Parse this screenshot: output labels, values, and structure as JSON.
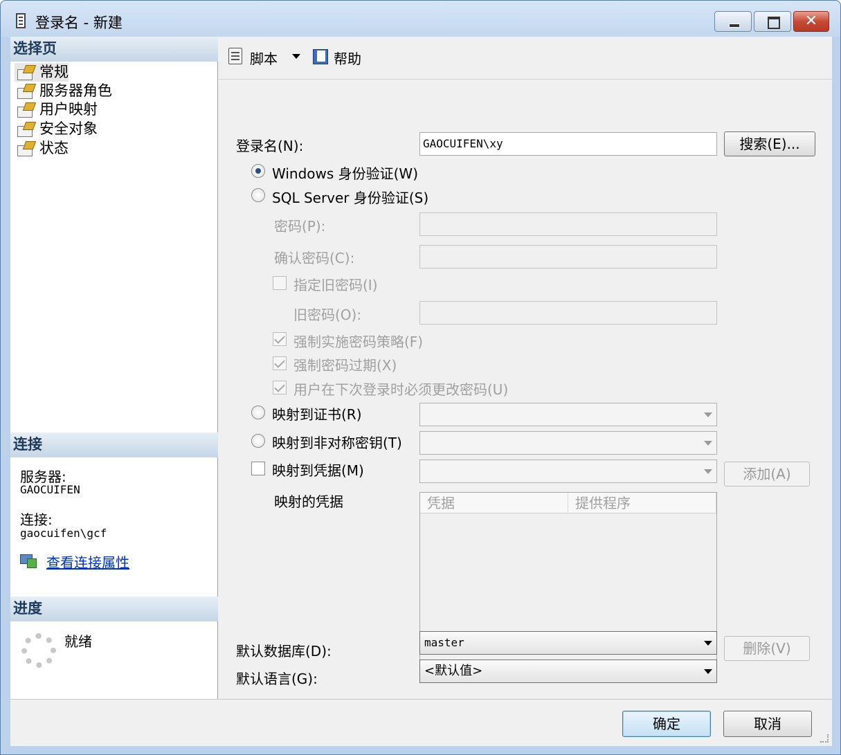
{
  "window": {
    "title": "登录名 - 新建",
    "close_label": "✕"
  },
  "left": {
    "select_page_header": "选择页",
    "pages": [
      "常规",
      "服务器角色",
      "用户映射",
      "安全对象",
      "状态"
    ],
    "connection_header": "连接",
    "server_label": "服务器:",
    "server_value": "GAOCUIFEN",
    "connection_label": "连接:",
    "connection_value": "gaocuifen\\gcf",
    "view_props_link": "查看连接属性",
    "progress_header": "进度",
    "progress_status": "就绪"
  },
  "toolbar": {
    "script_label": "脚本",
    "help_label": "帮助"
  },
  "form": {
    "login_name_label": "登录名(N):",
    "login_name_value": "GAOCUIFEN\\xy",
    "search_button": "搜索(E)...",
    "windows_auth": "Windows 身份验证(W)",
    "sql_auth": "SQL Server 身份验证(S)",
    "password_label": "密码(P):",
    "confirm_password_label": "确认密码(C):",
    "specify_old_password": "指定旧密码(I)",
    "old_password_label": "旧密码(O):",
    "enforce_policy": "强制实施密码策略(F)",
    "enforce_expiration": "强制密码过期(X)",
    "must_change": "用户在下次登录时必须更改密码(U)",
    "map_cert": "映射到证书(R)",
    "map_asym_key": "映射到非对称密钥(T)",
    "map_credential": "映射到凭据(M)",
    "add_button": "添加(A)",
    "mapped_credentials_label": "映射的凭据",
    "grid_col_credential": "凭据",
    "grid_col_provider": "提供程序",
    "delete_button": "删除(V)",
    "default_db_label": "默认数据库(D):",
    "default_db_value": "master",
    "default_lang_label": "默认语言(G):",
    "default_lang_value": "<默认值>"
  },
  "footer": {
    "ok_button": "确定",
    "cancel_button": "取消"
  }
}
